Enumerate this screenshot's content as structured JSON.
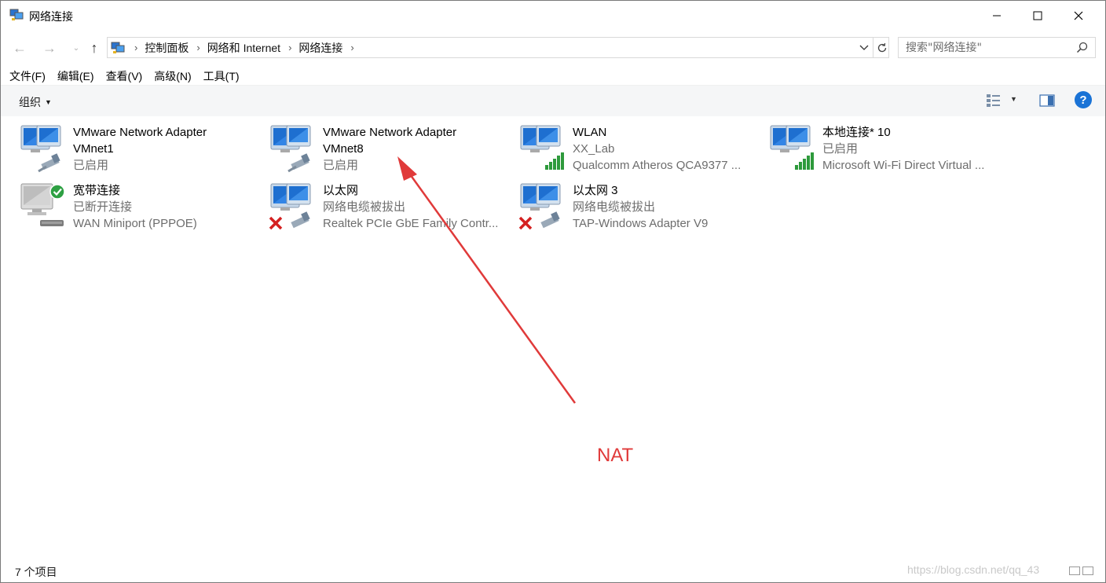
{
  "window": {
    "title": "网络连接"
  },
  "nav": {
    "back": "←",
    "forward": "→",
    "recent": "⌄",
    "up": "↑"
  },
  "breadcrumb": [
    "控制面板",
    "网络和 Internet",
    "网络连接"
  ],
  "search": {
    "placeholder": "搜索\"网络连接\""
  },
  "menu": {
    "file": "文件(F)",
    "edit": "编辑(E)",
    "view": "查看(V)",
    "advanced": "高级(N)",
    "tools": "工具(T)"
  },
  "toolbar": {
    "organize": "组织",
    "help": "?"
  },
  "connections": [
    {
      "name": "VMware Network Adapter",
      "name2": "VMnet1",
      "status": "已启用",
      "device": "",
      "icon": "ethernet-adapter-icon",
      "state": "enabled"
    },
    {
      "name": "VMware Network Adapter",
      "name2": "VMnet8",
      "status": "已启用",
      "device": "",
      "icon": "ethernet-adapter-icon",
      "state": "enabled"
    },
    {
      "name": "WLAN",
      "name2": "",
      "status": "XX_Lab",
      "device": "Qualcomm Atheros QCA9377 ...",
      "icon": "wifi-adapter-icon",
      "state": "connected"
    },
    {
      "name": "本地连接* 10",
      "name2": "",
      "status": "已启用",
      "device": "Microsoft Wi-Fi Direct Virtual ...",
      "icon": "wifi-adapter-icon",
      "state": "enabled"
    },
    {
      "name": "宽带连接",
      "name2": "",
      "status": "已断开连接",
      "device": "WAN Miniport (PPPOE)",
      "icon": "broadband-icon",
      "state": "disconnected"
    },
    {
      "name": "以太网",
      "name2": "",
      "status": "网络电缆被拔出",
      "device": "Realtek PCIe GbE Family Contr...",
      "icon": "ethernet-adapter-icon",
      "state": "unplugged"
    },
    {
      "name": "以太网 3",
      "name2": "",
      "status": "网络电缆被拔出",
      "device": "TAP-Windows Adapter V9",
      "icon": "ethernet-adapter-icon",
      "state": "unplugged"
    }
  ],
  "annotation": {
    "label": "NAT",
    "color": "#e03a3a"
  },
  "status": {
    "count": "7 个项目",
    "watermark": "https://blog.csdn.net/qq_43"
  },
  "colors": {
    "accent": "#1a73d6",
    "annotation": "#e03a3a",
    "wifi_bars": "#2e9a3c",
    "error": "#d42020"
  }
}
